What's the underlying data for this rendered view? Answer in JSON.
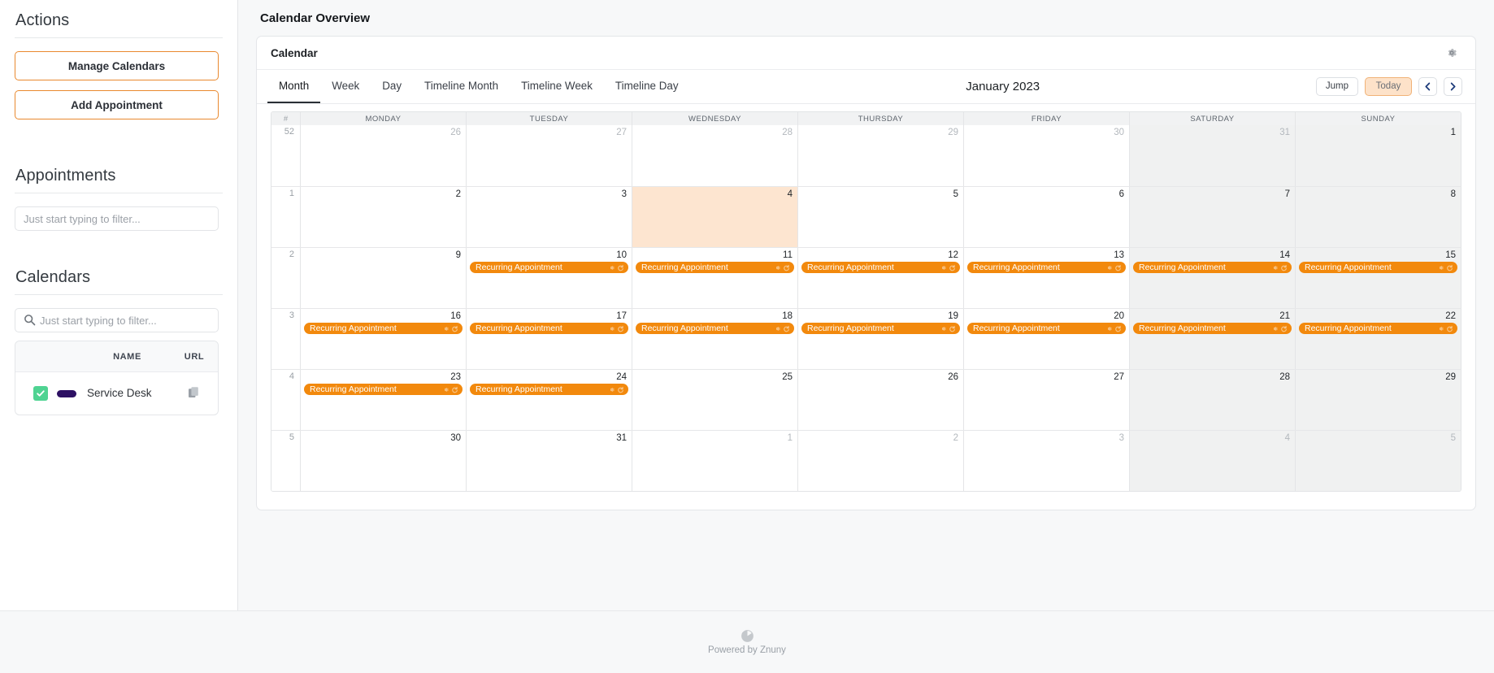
{
  "sidebar": {
    "actions_heading": "Actions",
    "manage_calendars_label": "Manage Calendars",
    "add_appointment_label": "Add Appointment",
    "appointments_heading": "Appointments",
    "appointments_filter_placeholder": "Just start typing to filter...",
    "appointments_filter_value": "",
    "calendars_heading": "Calendars",
    "calendars_filter_placeholder": "Just start typing to filter...",
    "calendars_filter_value": "",
    "calendars_table": {
      "columns": [
        "",
        "",
        "NAME",
        "URL"
      ],
      "header_name": "NAME",
      "header_url": "URL",
      "rows": [
        {
          "checked": true,
          "color": "#2d1063",
          "name": "Service Desk",
          "url_icon": "copy-icon"
        }
      ]
    }
  },
  "main": {
    "page_title": "Calendar Overview",
    "card_title": "Calendar",
    "settings_icon": "gear-icon",
    "tabs": [
      {
        "label": "Month",
        "active": true
      },
      {
        "label": "Week",
        "active": false
      },
      {
        "label": "Day",
        "active": false
      },
      {
        "label": "Timeline Month",
        "active": false
      },
      {
        "label": "Timeline Week",
        "active": false
      },
      {
        "label": "Timeline Day",
        "active": false
      }
    ],
    "current_period": "January 2023",
    "jump_label": "Jump",
    "today_label": "Today",
    "prev_icon": "chevron-left-icon",
    "next_icon": "chevron-right-icon"
  },
  "calendar": {
    "week_column_header": "#",
    "day_headers": [
      "MONDAY",
      "TUESDAY",
      "WEDNESDAY",
      "THURSDAY",
      "FRIDAY",
      "SATURDAY",
      "SUNDAY"
    ],
    "appointment_title": "Recurring Appointment",
    "accent_color": "#f2890d",
    "today_color": "#fde5d0",
    "weekend_color": "#f0f1f1",
    "weeks": [
      {
        "week_number": "52",
        "days": [
          {
            "num": "26",
            "other_month": true,
            "weekend": false,
            "today": false,
            "appointments": []
          },
          {
            "num": "27",
            "other_month": true,
            "weekend": false,
            "today": false,
            "appointments": []
          },
          {
            "num": "28",
            "other_month": true,
            "weekend": false,
            "today": false,
            "appointments": []
          },
          {
            "num": "29",
            "other_month": true,
            "weekend": false,
            "today": false,
            "appointments": []
          },
          {
            "num": "30",
            "other_month": true,
            "weekend": false,
            "today": false,
            "appointments": []
          },
          {
            "num": "31",
            "other_month": true,
            "weekend": true,
            "today": false,
            "appointments": []
          },
          {
            "num": "1",
            "other_month": false,
            "weekend": true,
            "today": false,
            "appointments": []
          }
        ]
      },
      {
        "week_number": "1",
        "days": [
          {
            "num": "2",
            "other_month": false,
            "weekend": false,
            "today": false,
            "appointments": []
          },
          {
            "num": "3",
            "other_month": false,
            "weekend": false,
            "today": false,
            "appointments": []
          },
          {
            "num": "4",
            "other_month": false,
            "weekend": false,
            "today": true,
            "appointments": []
          },
          {
            "num": "5",
            "other_month": false,
            "weekend": false,
            "today": false,
            "appointments": []
          },
          {
            "num": "6",
            "other_month": false,
            "weekend": false,
            "today": false,
            "appointments": []
          },
          {
            "num": "7",
            "other_month": false,
            "weekend": true,
            "today": false,
            "appointments": []
          },
          {
            "num": "8",
            "other_month": false,
            "weekend": true,
            "today": false,
            "appointments": []
          }
        ]
      },
      {
        "week_number": "2",
        "days": [
          {
            "num": "9",
            "other_month": false,
            "weekend": false,
            "today": false,
            "appointments": []
          },
          {
            "num": "10",
            "other_month": false,
            "weekend": false,
            "today": false,
            "appointments": [
              "Recurring Appointment"
            ]
          },
          {
            "num": "11",
            "other_month": false,
            "weekend": false,
            "today": false,
            "appointments": [
              "Recurring Appointment"
            ]
          },
          {
            "num": "12",
            "other_month": false,
            "weekend": false,
            "today": false,
            "appointments": [
              "Recurring Appointment"
            ]
          },
          {
            "num": "13",
            "other_month": false,
            "weekend": false,
            "today": false,
            "appointments": [
              "Recurring Appointment"
            ]
          },
          {
            "num": "14",
            "other_month": false,
            "weekend": true,
            "today": false,
            "appointments": [
              "Recurring Appointment"
            ]
          },
          {
            "num": "15",
            "other_month": false,
            "weekend": true,
            "today": false,
            "appointments": [
              "Recurring Appointment"
            ]
          }
        ]
      },
      {
        "week_number": "3",
        "days": [
          {
            "num": "16",
            "other_month": false,
            "weekend": false,
            "today": false,
            "appointments": [
              "Recurring Appointment"
            ]
          },
          {
            "num": "17",
            "other_month": false,
            "weekend": false,
            "today": false,
            "appointments": [
              "Recurring Appointment"
            ]
          },
          {
            "num": "18",
            "other_month": false,
            "weekend": false,
            "today": false,
            "appointments": [
              "Recurring Appointment"
            ]
          },
          {
            "num": "19",
            "other_month": false,
            "weekend": false,
            "today": false,
            "appointments": [
              "Recurring Appointment"
            ]
          },
          {
            "num": "20",
            "other_month": false,
            "weekend": false,
            "today": false,
            "appointments": [
              "Recurring Appointment"
            ]
          },
          {
            "num": "21",
            "other_month": false,
            "weekend": true,
            "today": false,
            "appointments": [
              "Recurring Appointment"
            ]
          },
          {
            "num": "22",
            "other_month": false,
            "weekend": true,
            "today": false,
            "appointments": [
              "Recurring Appointment"
            ]
          }
        ]
      },
      {
        "week_number": "4",
        "days": [
          {
            "num": "23",
            "other_month": false,
            "weekend": false,
            "today": false,
            "appointments": [
              "Recurring Appointment"
            ]
          },
          {
            "num": "24",
            "other_month": false,
            "weekend": false,
            "today": false,
            "appointments": [
              "Recurring Appointment"
            ]
          },
          {
            "num": "25",
            "other_month": false,
            "weekend": false,
            "today": false,
            "appointments": []
          },
          {
            "num": "26",
            "other_month": false,
            "weekend": false,
            "today": false,
            "appointments": []
          },
          {
            "num": "27",
            "other_month": false,
            "weekend": false,
            "today": false,
            "appointments": []
          },
          {
            "num": "28",
            "other_month": false,
            "weekend": true,
            "today": false,
            "appointments": []
          },
          {
            "num": "29",
            "other_month": false,
            "weekend": true,
            "today": false,
            "appointments": []
          }
        ]
      },
      {
        "week_number": "5",
        "days": [
          {
            "num": "30",
            "other_month": false,
            "weekend": false,
            "today": false,
            "appointments": []
          },
          {
            "num": "31",
            "other_month": false,
            "weekend": false,
            "today": false,
            "appointments": []
          },
          {
            "num": "1",
            "other_month": true,
            "weekend": false,
            "today": false,
            "appointments": []
          },
          {
            "num": "2",
            "other_month": true,
            "weekend": false,
            "today": false,
            "appointments": []
          },
          {
            "num": "3",
            "other_month": true,
            "weekend": false,
            "today": false,
            "appointments": []
          },
          {
            "num": "4",
            "other_month": true,
            "weekend": true,
            "today": false,
            "appointments": []
          },
          {
            "num": "5",
            "other_month": true,
            "weekend": true,
            "today": false,
            "appointments": []
          }
        ]
      }
    ]
  },
  "footer": {
    "text": "Powered by Znuny",
    "logo_icon": "znuny-logo-icon"
  }
}
